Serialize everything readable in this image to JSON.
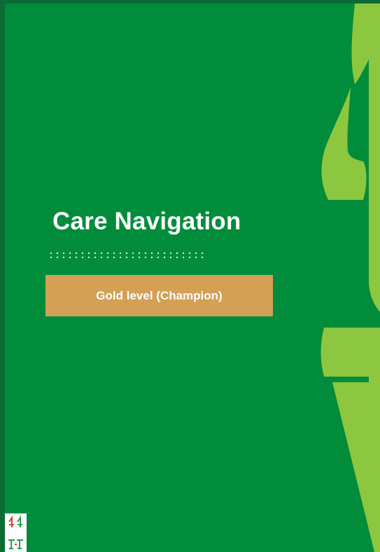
{
  "document": {
    "title": "Care Navigation",
    "level_badge": "Gold level (Champion)"
  },
  "colors": {
    "outer_frame": "#0b6b34",
    "background": "#008c3b",
    "accent_lime": "#8dc63f",
    "badge": "#d4a055",
    "text": "#ffffff"
  },
  "icons": {
    "decoration": "large-quotation-mark-graphic",
    "dot_separator": "dotted-divider",
    "logo": "organisation-logo"
  }
}
